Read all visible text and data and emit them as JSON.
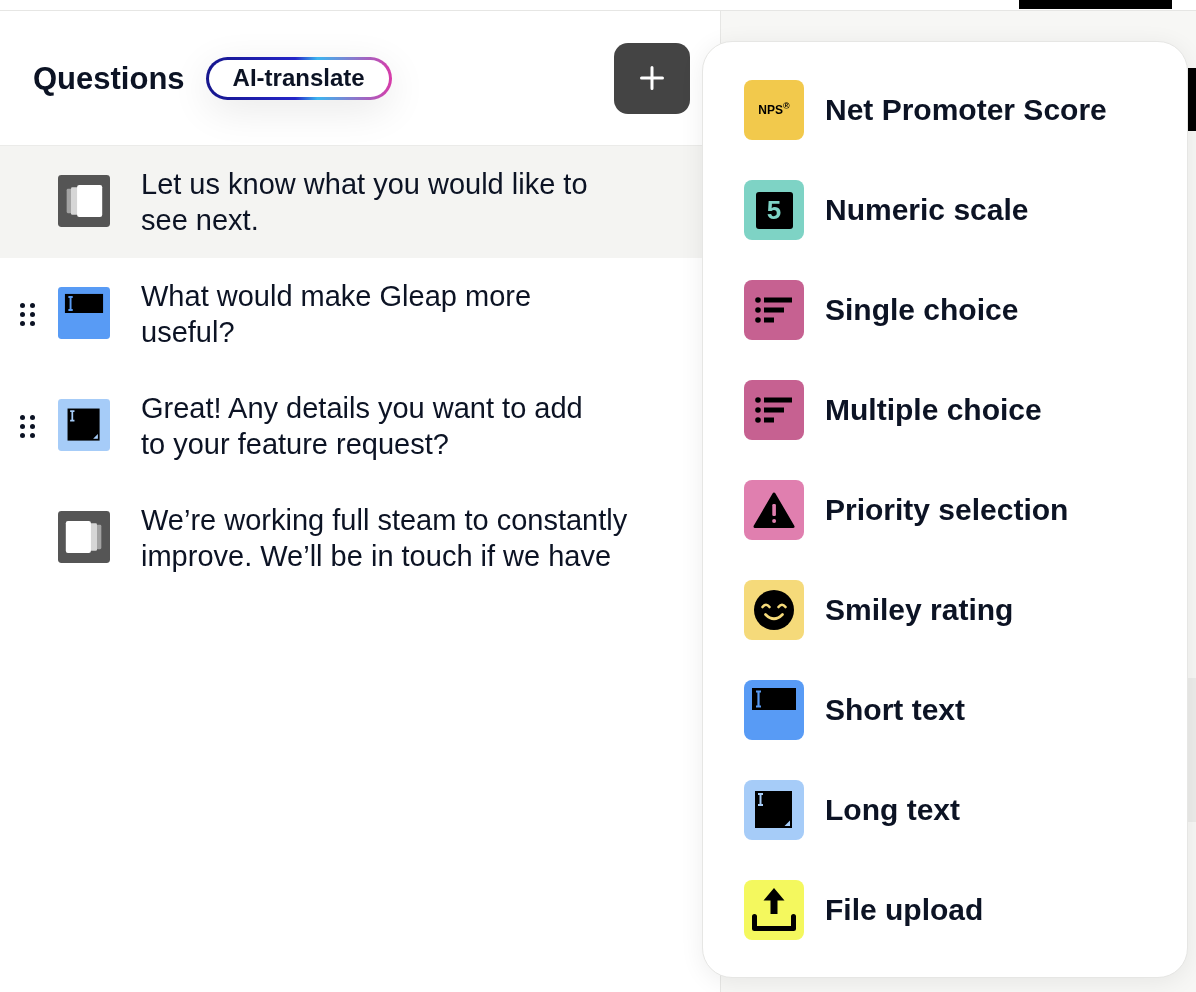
{
  "header": {
    "title": "Questions",
    "translate_button": "AI-translate"
  },
  "questions": [
    {
      "kind": "intro_card",
      "color": "#555555",
      "text": "Let us know what you would like to\nsee next.",
      "selected": true,
      "draggable": false
    },
    {
      "kind": "short_text",
      "color": "#589bf5",
      "text": "What would make Gleap more\nuseful?",
      "selected": false,
      "draggable": true
    },
    {
      "kind": "long_text",
      "color": "#a6ccf8",
      "text": "Great! Any details you want to add\nto your feature request?",
      "selected": false,
      "draggable": true
    },
    {
      "kind": "outro_card",
      "color": "#555555",
      "text": "We’re working full steam to constantly\nimprove. We’ll be in touch if we have",
      "selected": false,
      "draggable": false
    }
  ],
  "menu": {
    "items": [
      {
        "kind": "nps",
        "color": "#f2c94c",
        "badge": "NPS$^{®}$",
        "label": "Net Promoter Score"
      },
      {
        "kind": "numeric",
        "color": "#7ed3c5",
        "badge": "5",
        "label": "Numeric scale"
      },
      {
        "kind": "single_choice",
        "color": "#c66191",
        "label": "Single choice"
      },
      {
        "kind": "multiple_choice",
        "color": "#c66191",
        "label": "Multiple choice"
      },
      {
        "kind": "priority",
        "color": "#e07faf",
        "label": "Priority selection"
      },
      {
        "kind": "smiley",
        "color": "#f5da7a",
        "label": "Smiley rating"
      },
      {
        "kind": "short_text",
        "color": "#589bf5",
        "label": "Short text"
      },
      {
        "kind": "long_text",
        "color": "#a6ccf8",
        "label": "Long text"
      },
      {
        "kind": "file_upload",
        "color": "#f4f85e",
        "label": "File upload"
      }
    ]
  }
}
